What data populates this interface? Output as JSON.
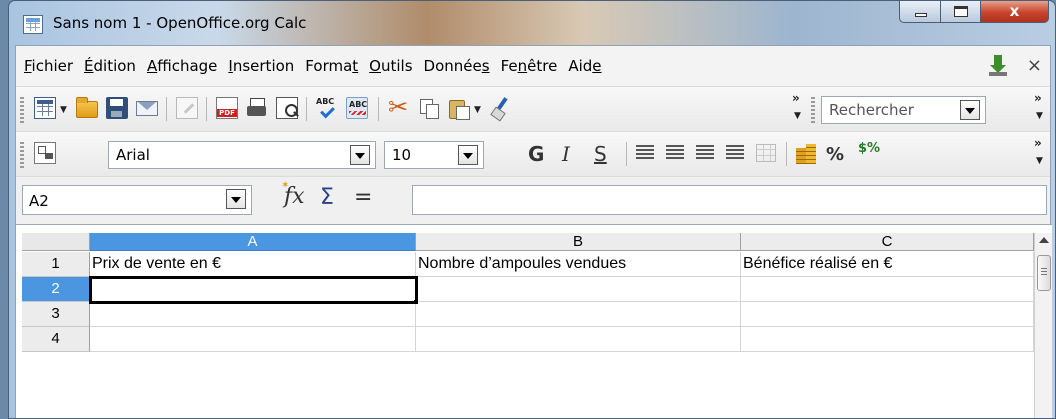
{
  "window": {
    "title": "Sans nom 1 - OpenOffice.org Calc",
    "close_glyph": "x"
  },
  "menu": {
    "items": [
      {
        "pre": "",
        "u": "F",
        "post": "ichier"
      },
      {
        "pre": "",
        "u": "É",
        "post": "dition"
      },
      {
        "pre": "",
        "u": "A",
        "post": "ffichage"
      },
      {
        "pre": "",
        "u": "I",
        "post": "nsertion"
      },
      {
        "pre": "Forma",
        "u": "t",
        "post": ""
      },
      {
        "pre": "",
        "u": "O",
        "post": "utils"
      },
      {
        "pre": "Donnée",
        "u": "s",
        "post": ""
      },
      {
        "pre": "Fe",
        "u": "n",
        "post": "être"
      },
      {
        "pre": "Aid",
        "u": "e",
        "post": ""
      }
    ],
    "close_glyph": "×"
  },
  "toolbar": {
    "search_placeholder": "Rechercher"
  },
  "format_bar": {
    "font_name": "Arial",
    "font_size": "10",
    "bold_label": "G",
    "italic_label": "I",
    "underline_label": "S",
    "percent_label": "%",
    "currency_label": "$%"
  },
  "formula_bar": {
    "cell_ref": "A2",
    "fx_label": "fx",
    "sigma_label": "Σ",
    "equals_label": "=",
    "content": ""
  },
  "sheet": {
    "columns": [
      "A",
      "B",
      "C"
    ],
    "rows": [
      {
        "num": "1",
        "cells": [
          "Prix de vente en €",
          "Nombre d’ampoules vendues",
          "Bénéfice réalisé en €"
        ]
      },
      {
        "num": "2",
        "cells": [
          "",
          "",
          ""
        ]
      },
      {
        "num": "3",
        "cells": [
          "",
          "",
          ""
        ]
      },
      {
        "num": "4",
        "cells": [
          "",
          "",
          ""
        ]
      }
    ],
    "selected_cell": "A2"
  },
  "colors": {
    "selection": "#4a96e0",
    "close_button": "#c8432b"
  }
}
